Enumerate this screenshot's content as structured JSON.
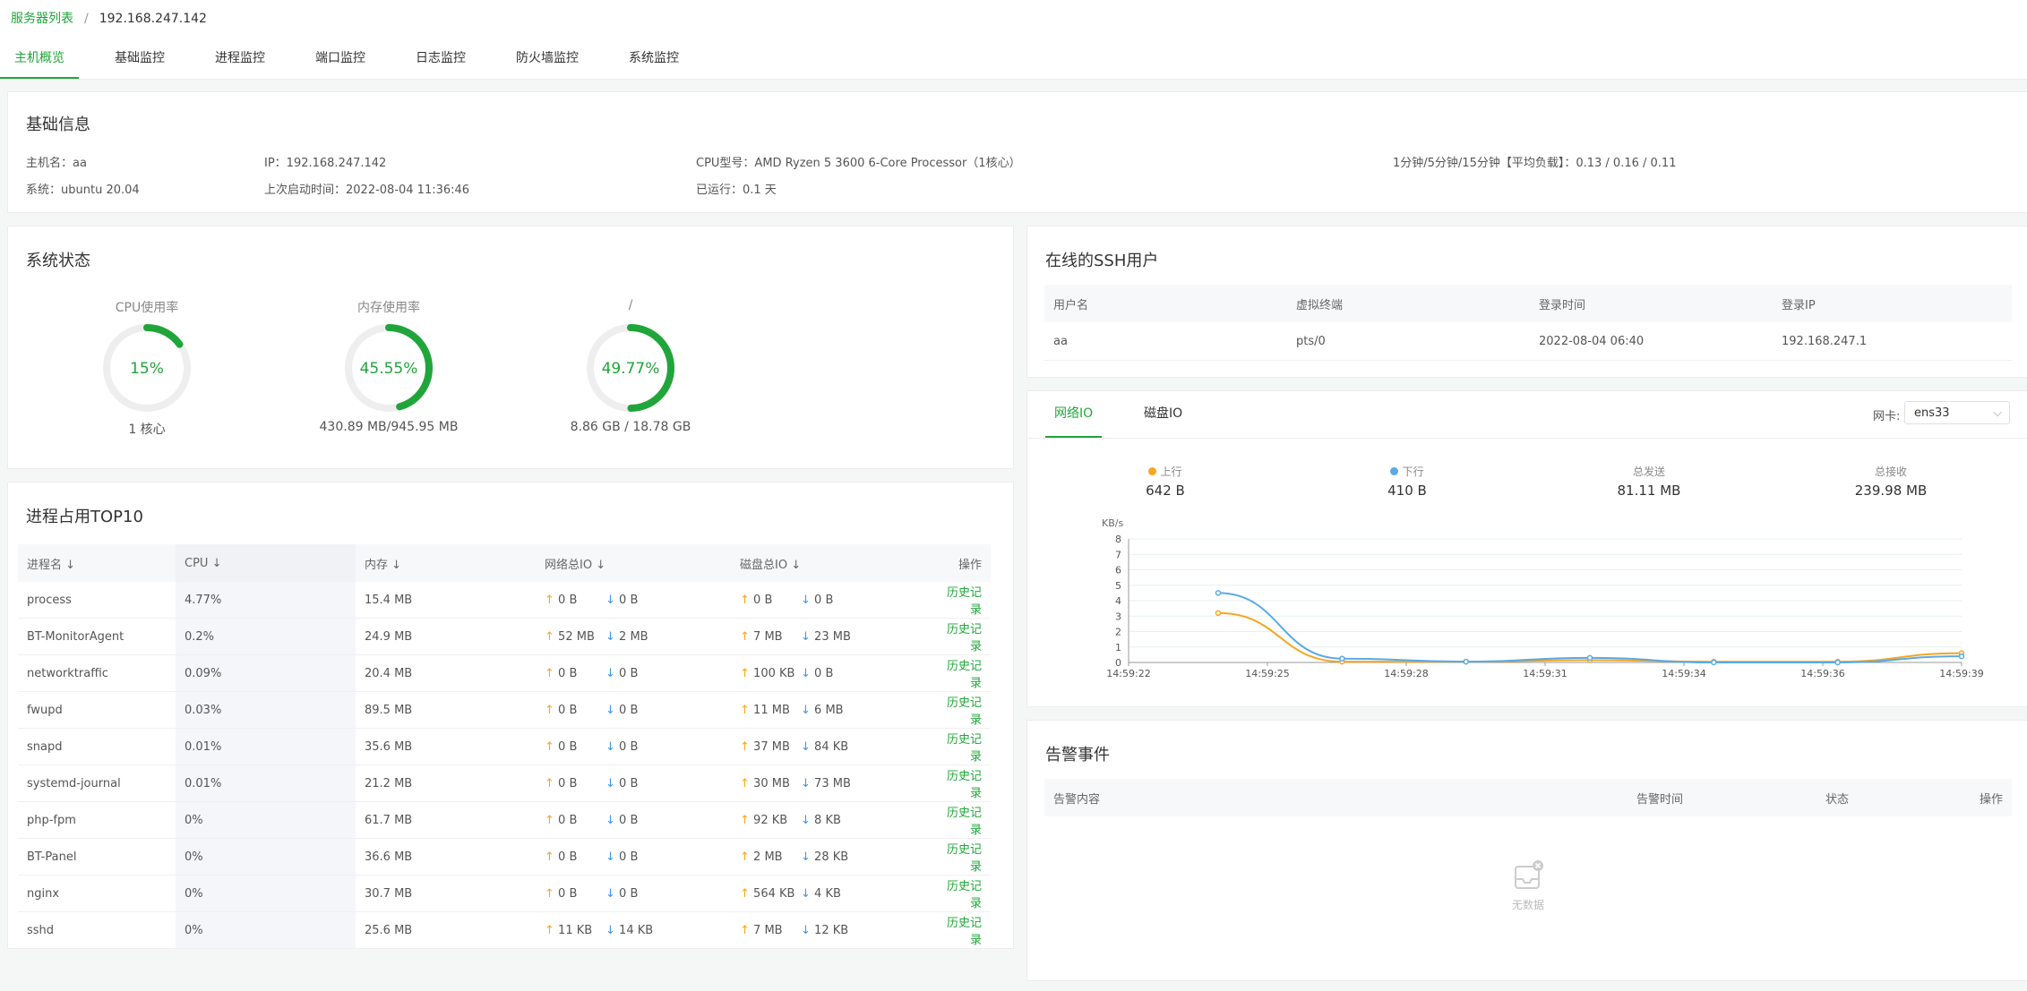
{
  "breadcrumb": {
    "root": "服务器列表",
    "sep": "/",
    "current": "192.168.247.142"
  },
  "tabs": [
    "主机概览",
    "基础监控",
    "进程监控",
    "端口监控",
    "日志监控",
    "防火墙监控",
    "系统监控"
  ],
  "basic": {
    "title": "基础信息",
    "hostname": "主机名：aa",
    "ip": "IP：192.168.247.142",
    "cpu_model": "CPU型号：AMD Ryzen 5 3600 6-Core Processor（1核心）",
    "load": "1分钟/5分钟/15分钟【平均负载】：0.13 / 0.16 / 0.11",
    "system": "系统：ubuntu 20.04",
    "boot": "上次启动时间：2022-08-04 11:36:46",
    "uptime": "已运行：0.1 天"
  },
  "status": {
    "title": "系统状态",
    "gauges": [
      {
        "label": "CPU使用率",
        "value_text": "15%",
        "fraction": 0.15,
        "sub": "1 核心"
      },
      {
        "label": "内存使用率",
        "value_text": "45.55%",
        "fraction": 0.4555,
        "sub": "430.89 MB/945.95 MB"
      },
      {
        "label": "/",
        "value_text": "49.77%",
        "fraction": 0.4977,
        "sub": "8.86 GB / 18.78 GB"
      }
    ],
    "colors": {
      "arc": "#20a53a",
      "track": "#eeeeee"
    }
  },
  "top10": {
    "title": "进程占用TOP10",
    "headers": [
      "进程名",
      "CPU",
      "内存",
      "网络总IO",
      "磁盘总IO",
      "操作"
    ],
    "rows": [
      {
        "name": "process",
        "cpu": "4.77%",
        "mem": "15.4 MB",
        "net_up": "0 B",
        "net_down": "0 B",
        "disk_up": "0 B",
        "disk_down": "0 B",
        "action": "历史记录"
      },
      {
        "name": "BT-MonitorAgent",
        "cpu": "0.2%",
        "mem": "24.9 MB",
        "net_up": "52 MB",
        "net_down": "2 MB",
        "disk_up": "7 MB",
        "disk_down": "23 MB",
        "action": "历史记录"
      },
      {
        "name": "networktraffic",
        "cpu": "0.09%",
        "mem": "20.4 MB",
        "net_up": "0 B",
        "net_down": "0 B",
        "disk_up": "100 KB",
        "disk_down": "0 B",
        "action": "历史记录"
      },
      {
        "name": "fwupd",
        "cpu": "0.03%",
        "mem": "89.5 MB",
        "net_up": "0 B",
        "net_down": "0 B",
        "disk_up": "11 MB",
        "disk_down": "6 MB",
        "action": "历史记录"
      },
      {
        "name": "snapd",
        "cpu": "0.01%",
        "mem": "35.6 MB",
        "net_up": "0 B",
        "net_down": "0 B",
        "disk_up": "37 MB",
        "disk_down": "84 KB",
        "action": "历史记录"
      },
      {
        "name": "systemd-journal",
        "cpu": "0.01%",
        "mem": "21.2 MB",
        "net_up": "0 B",
        "net_down": "0 B",
        "disk_up": "30 MB",
        "disk_down": "73 MB",
        "action": "历史记录"
      },
      {
        "name": "php-fpm",
        "cpu": "0%",
        "mem": "61.7 MB",
        "net_up": "0 B",
        "net_down": "0 B",
        "disk_up": "92 KB",
        "disk_down": "8 KB",
        "action": "历史记录"
      },
      {
        "name": "BT-Panel",
        "cpu": "0%",
        "mem": "36.6 MB",
        "net_up": "0 B",
        "net_down": "0 B",
        "disk_up": "2 MB",
        "disk_down": "28 KB",
        "action": "历史记录"
      },
      {
        "name": "nginx",
        "cpu": "0%",
        "mem": "30.7 MB",
        "net_up": "0 B",
        "net_down": "0 B",
        "disk_up": "564 KB",
        "disk_down": "4 KB",
        "action": "历史记录"
      },
      {
        "name": "sshd",
        "cpu": "0%",
        "mem": "25.6 MB",
        "net_up": "11 KB",
        "net_down": "14 KB",
        "disk_up": "7 MB",
        "disk_down": "12 KB",
        "action": "历史记录"
      }
    ]
  },
  "ssh": {
    "title": "在线的SSH用户",
    "headers": [
      "用户名",
      "虚拟终端",
      "登录时间",
      "登录IP"
    ],
    "rows": [
      {
        "user": "aa",
        "tty": "pts/0",
        "time": "2022-08-04 06:40",
        "ip": "192.168.247.1"
      }
    ]
  },
  "io": {
    "tabs": [
      "网络IO",
      "磁盘IO"
    ],
    "nic_label": "网卡:",
    "nic_value": "ens33",
    "stats": [
      {
        "label": "上行",
        "value": "642 B",
        "color": "#f5a623"
      },
      {
        "label": "下行",
        "value": "410 B",
        "color": "#5aa9e6"
      },
      {
        "label": "总发送",
        "value": "81.11 MB"
      },
      {
        "label": "总接收",
        "value": "239.98 MB"
      }
    ]
  },
  "chart_data": {
    "type": "line",
    "ylabel": "KB/s",
    "ylim": [
      0,
      8
    ],
    "yticks": [
      0,
      1,
      2,
      3,
      4,
      5,
      6,
      7,
      8
    ],
    "xticks": [
      "14:59:22",
      "14:59:25",
      "14:59:28",
      "14:59:31",
      "14:59:34",
      "14:59:36",
      "14:59:39"
    ],
    "x": [
      "14:59:24",
      "14:59:27",
      "14:59:30",
      "14:59:33",
      "14:59:36",
      "14:59:39",
      "14:59:39"
    ],
    "series": [
      {
        "name": "上行",
        "color": "#f5a623",
        "values": [
          3.2,
          0.05,
          0.05,
          0.15,
          0.05,
          0.05,
          0.6
        ]
      },
      {
        "name": "下行",
        "color": "#5aa9e6",
        "values": [
          4.5,
          0.25,
          0.05,
          0.3,
          0.0,
          0.0,
          0.4
        ]
      }
    ],
    "grid": true
  },
  "alerts": {
    "title": "告警事件",
    "headers": [
      "告警内容",
      "告警时间",
      "状态",
      "操作"
    ],
    "empty_text": "无数据"
  }
}
